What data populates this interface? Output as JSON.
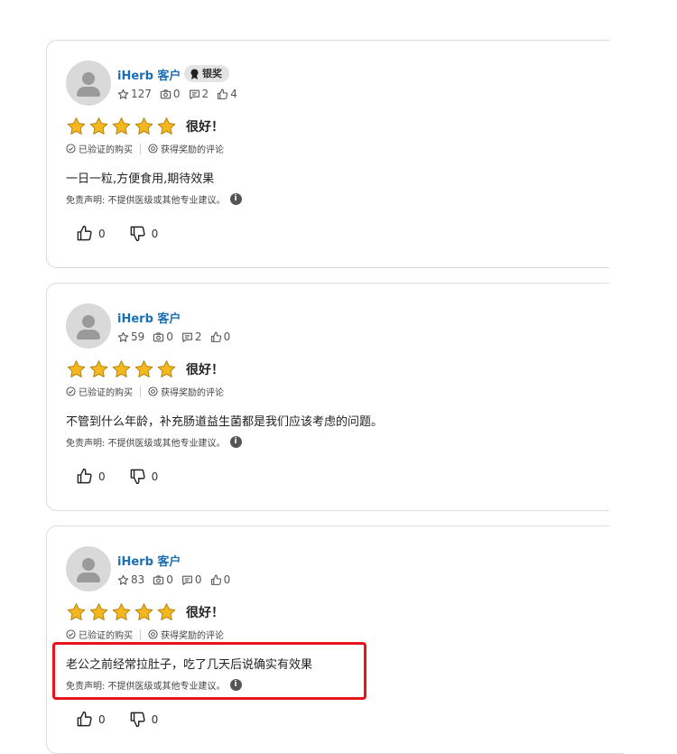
{
  "reviews": [
    {
      "reviewer_name": "iHerb 客户",
      "badge": "银奖",
      "stats": {
        "stars": "127",
        "photos": "0",
        "comments": "2",
        "likes": "4"
      },
      "rating": 5,
      "rating_title": "很好！",
      "verified_label": "已验证的购买",
      "rewarded_label": "获得奖励的评论",
      "text": "一日一粒,方便食用,期待效果",
      "disclaimer": "免责声明: 不提供医级或其他专业建议。",
      "helpful_count": "0",
      "unhelpful_count": "0"
    },
    {
      "reviewer_name": "iHerb 客户",
      "stats": {
        "stars": "59",
        "photos": "0",
        "comments": "2",
        "likes": "0"
      },
      "rating": 5,
      "rating_title": "很好！",
      "verified_label": "已验证的购买",
      "rewarded_label": "获得奖励的评论",
      "text": "不管到什么年龄，补充肠道益生菌都是我们应该考虑的问题。",
      "disclaimer": "免责声明: 不提供医级或其他专业建议。",
      "helpful_count": "0",
      "unhelpful_count": "0"
    },
    {
      "reviewer_name": "iHerb 客户",
      "stats": {
        "stars": "83",
        "photos": "0",
        "comments": "0",
        "likes": "0"
      },
      "rating": 5,
      "rating_title": "很好！",
      "verified_label": "已验证的购买",
      "rewarded_label": "获得奖励的评论",
      "text": "老公之前经常拉肚子，吃了几天后说确实有效果",
      "disclaimer": "免责声明: 不提供医级或其他专业建议。",
      "helpful_count": "0",
      "unhelpful_count": "0"
    }
  ],
  "colors": {
    "star": "#f5b71e",
    "name_link": "#1a6fb5",
    "highlight": "#e8141b"
  },
  "icons": {
    "avatar": "user-avatar-icon",
    "badge": "award-ribbon-icon",
    "stars": "star-outline-icon",
    "photos": "camera-icon",
    "comments": "comment-icon",
    "likes": "thumbs-up-outline-icon",
    "verified": "check-circle-icon",
    "rewarded": "reward-circle-icon",
    "info": "info-icon",
    "helpful": "thumbs-up-icon",
    "unhelpful": "thumbs-down-icon"
  },
  "info_glyph": "i"
}
